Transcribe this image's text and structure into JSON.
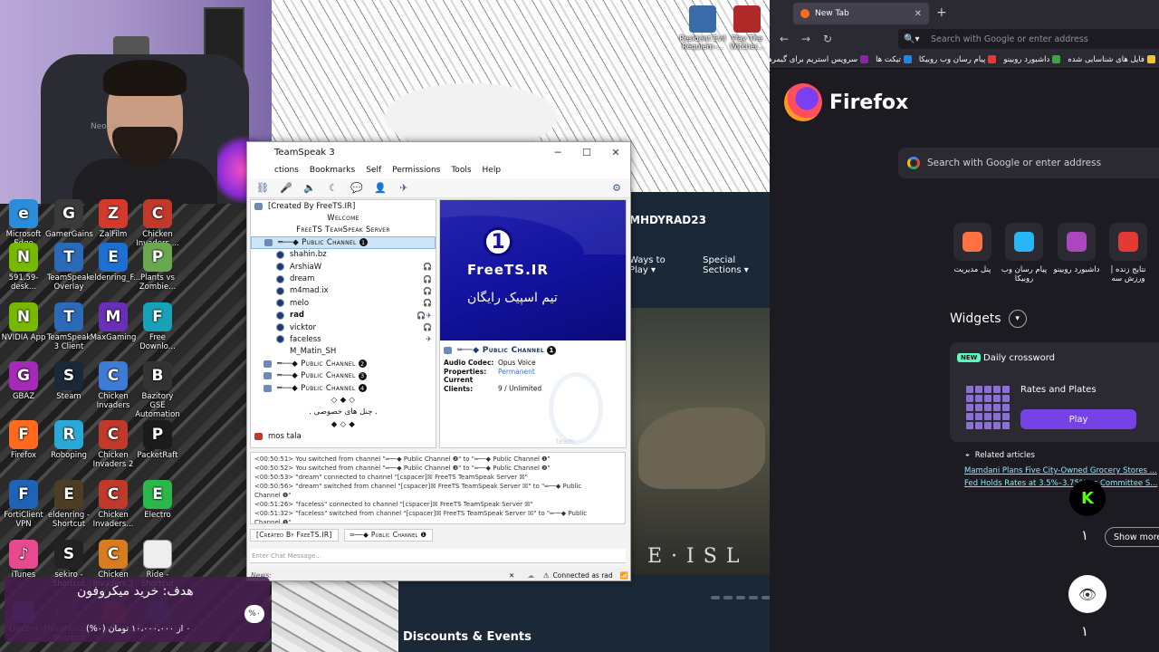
{
  "webcam": {
    "nameplate": "Neova"
  },
  "desktop_icons": [
    {
      "label": "Microsoft Edge",
      "color": "#2c8cd8",
      "glyph": "e"
    },
    {
      "label": "GamerGains",
      "color": "#3a3a3a",
      "glyph": "G"
    },
    {
      "label": "ZalFilm",
      "color": "#d33a2c",
      "glyph": "Z"
    },
    {
      "label": "Chicken Invaders ...",
      "color": "#c0392b",
      "glyph": "C"
    },
    {
      "label": "591.59-desk...",
      "color": "#76b900",
      "glyph": "N"
    },
    {
      "label": "TeamSpeak Overlay",
      "color": "#2a6ab8",
      "glyph": "T"
    },
    {
      "label": "eldenring_F...",
      "color": "#1d6fd1",
      "glyph": "E"
    },
    {
      "label": "Plants vs Zombie...",
      "color": "#6aa84f",
      "glyph": "P"
    },
    {
      "label": "NVIDIA App",
      "color": "#76b900",
      "glyph": "N"
    },
    {
      "label": "TeamSpeak 3 Client",
      "color": "#2a6ab8",
      "glyph": "T"
    },
    {
      "label": "MaxGaming",
      "color": "#6a2fb8",
      "glyph": "M"
    },
    {
      "label": "Free Downlo...",
      "color": "#17a2b8",
      "glyph": "F"
    },
    {
      "label": "GBAZ",
      "color": "#a32bb8",
      "glyph": "G"
    },
    {
      "label": "Steam",
      "color": "#1b2838",
      "glyph": "S"
    },
    {
      "label": "Chicken Invaders",
      "color": "#3d7bd6",
      "glyph": "C"
    },
    {
      "label": "Bazitory GSE Automation",
      "color": "#333333",
      "glyph": "B"
    },
    {
      "label": "Firefox",
      "color": "#ff6a1f",
      "glyph": "F"
    },
    {
      "label": "Roboping",
      "color": "#2aa8d6",
      "glyph": "R"
    },
    {
      "label": "Chicken Invaders 2",
      "color": "#c0392b",
      "glyph": "C"
    },
    {
      "label": "PacketRaft",
      "color": "#1b1b1b",
      "glyph": "P"
    },
    {
      "label": "FortiClient VPN",
      "color": "#1f63b6",
      "glyph": "F"
    },
    {
      "label": "eldenring - Shortcut",
      "color": "#4d3d22",
      "glyph": "E"
    },
    {
      "label": "Chicken Invaders...",
      "color": "#c0392b",
      "glyph": "C"
    },
    {
      "label": "Electro",
      "color": "#2ab84a",
      "glyph": "E"
    },
    {
      "label": "iTunes",
      "color": "#e84a8f",
      "glyph": "♪"
    },
    {
      "label": "sekiro - Shortcut",
      "color": "#222222",
      "glyph": "S"
    },
    {
      "label": "Chicken Invaders 3",
      "color": "#d97c1f",
      "glyph": "C"
    },
    {
      "label": "Ride - Shortcut",
      "color": "#eeeeee",
      "glyph": ""
    }
  ],
  "bottom_icons": [
    {
      "label": "Discord",
      "color": "#5865f2"
    },
    {
      "label": "ForzaHoriz... - Shortcut",
      "color": "#444444"
    },
    {
      "label": "invaders...",
      "color": "#c0392b"
    },
    {
      "label": "Simulato...",
      "color": "#2c5aa0"
    }
  ],
  "top_game_icons": [
    {
      "label": "Resident Evil Requiem-...",
      "color": "#3b6aa8"
    },
    {
      "label": "Play The Witcher...",
      "color": "#b02a2a"
    }
  ],
  "steam": {
    "username": "MHDYRAD23",
    "nav": [
      "Ways to Play ▾",
      "Special Sections ▾"
    ],
    "hero_word": "E·ISL",
    "section": "Discounts & Events"
  },
  "teamspeak": {
    "title": "TeamSpeak 3",
    "menu": [
      "ctions",
      "Bookmarks",
      "Self",
      "Permissions",
      "Tools",
      "Help"
    ],
    "tree": [
      {
        "text": "[Created By FreeTS.IR]",
        "kind": "server"
      },
      {
        "text": "Welcome",
        "kind": "spacer"
      },
      {
        "text": "FreeTS TeamSpeak Server",
        "kind": "spacer"
      },
      {
        "text": "═──◆ Public Channel",
        "kind": "channel",
        "badge": "1",
        "selected": true
      },
      {
        "text": "shahin.bz",
        "kind": "client"
      },
      {
        "text": "ArshiaW",
        "kind": "client",
        "right": "🎧"
      },
      {
        "text": "dream",
        "kind": "client",
        "right": "🎧"
      },
      {
        "text": "m4mad.ix",
        "kind": "client",
        "right": "🎧"
      },
      {
        "text": "melo",
        "kind": "client",
        "right": "🎧"
      },
      {
        "text": "rad",
        "kind": "client-bold",
        "right": "🎧✈"
      },
      {
        "text": "vicktor",
        "kind": "client",
        "right": "🎧"
      },
      {
        "text": "faceless",
        "kind": "client",
        "right": "✈"
      },
      {
        "text": "M_Matin_SH",
        "kind": "client-bot"
      },
      {
        "text": "═──◆ Public Channel",
        "kind": "channel",
        "badge": "2"
      },
      {
        "text": "═──◆ Public Channel",
        "kind": "channel",
        "badge": "3"
      },
      {
        "text": "═──◆ Public Channel",
        "kind": "channel",
        "badge": "4"
      },
      {
        "text": "◇ ◆ ◇",
        "kind": "spacer"
      },
      {
        "text": ". چنل های خصوصی .",
        "kind": "spacer"
      },
      {
        "text": "◆ ◇ ◆",
        "kind": "spacer"
      },
      {
        "text": "mos tala",
        "kind": "group"
      }
    ],
    "banner": {
      "number": "1",
      "brand": "FreeTS.IR",
      "subtitle": "تیم اسپیک رایگان"
    },
    "info": {
      "channel": "═──◆ Public Channel",
      "badge": "1",
      "codec_label": "Audio Codec:",
      "codec": "Opus Voice",
      "props_label": "Properties:",
      "props": "Permanent",
      "clients_label": "Current Clients:",
      "clients": "9 / Unlimited",
      "watermark": "team"
    },
    "log": [
      "<00:50:51> You switched from channel \"═──◆ Public Channel ❷\" to \"═──◆ Public Channel ❶\"",
      "<00:50:52> You switched from channel \"═──◆ Public Channel ❸\" to \"═──◆ Public Channel ❷\"",
      "<00:50:53> \"dream\" connected to channel \"[cspacer]☒ FreeTS TeamSpeak Server ☒\"",
      "<00:50:56> \"dream\" switched from channel \"[cspacer]☒ FreeTS TeamSpeak Server ☒\" to \"═──◆ Public",
      "Channel ❶\"",
      "<00:51:26> \"faceless\" connected to channel \"[cspacer]☒ FreeTS TeamSpeak Server ☒\"",
      "<00:51:32> \"faceless\" switched from channel \"[cspacer]☒ FreeTS TeamSpeak Server ☒\" to \"═──◆ Public",
      "Channel ❶\""
    ],
    "tabs": [
      "[Created By FreeTS.IR]",
      "═──◆ Public Channel ❶"
    ],
    "chat_placeholder": "Enter Chat Message...",
    "news_label": "News:",
    "status": "Connected as rad"
  },
  "goal": {
    "title": "هدف: خرید میکروفون",
    "percent": "%۰",
    "progress": "۰ از ۱۰،۰۰۰،۰۰۰ تومان (۰%)"
  },
  "firefox": {
    "tab_title": "New Tab",
    "url_placeholder": "Search with Google or enter address",
    "bookmarks": [
      "فایل های شناسایی شده",
      "داشبورد روبینو",
      "پیام رسان وب روبیکا",
      "تیکت ها",
      "سرویس استریم برای گیمرها"
    ],
    "bookmark_colors": [
      "#f1c232",
      "#43a047",
      "#e53935",
      "#1e88e5",
      "#8e24aa"
    ],
    "brand": "Firefox",
    "search_placeholder": "Search with Google or enter address",
    "shortcuts": [
      {
        "label": "پنل مدیریت",
        "color": "#ff7043"
      },
      {
        "label": "پیام رسان وب روبیکا",
        "color": "#29b6f6"
      },
      {
        "label": "داشبورد روبینو",
        "color": "#ab47bc"
      },
      {
        "label": "نتایج زنده | ورزش سه",
        "color": "#e53935"
      }
    ],
    "widgets_label": "Widgets",
    "card": {
      "badge": "NEW",
      "title": "Daily crossword",
      "puzzle": "Rates and Plates",
      "play": "Play"
    },
    "related_label": "Related articles",
    "articles": [
      "Mamdani Plans Five City-Owned Grocery Stores ...",
      "Fed Holds Rates at 3.5%–3.75% as Committee S..."
    ],
    "kick_glyph": "K",
    "counts": [
      "۱",
      "۱"
    ],
    "show_more": "Show more"
  }
}
